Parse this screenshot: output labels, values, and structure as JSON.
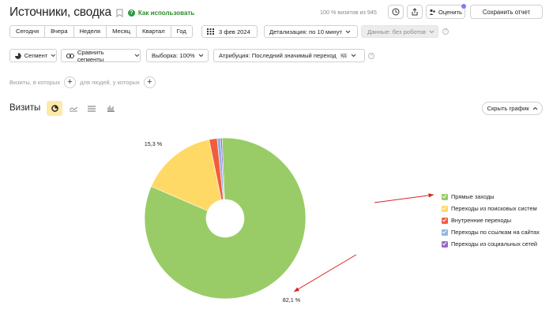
{
  "header": {
    "title": "Источники, сводка",
    "howto_label": "Как использовать",
    "visits_info": "100 % визитов из 945",
    "rate_label": "Оценить",
    "save_label": "Сохранить отчет"
  },
  "periods": [
    "Сегодня",
    "Вчера",
    "Неделя",
    "Месяц",
    "Квартал",
    "Год"
  ],
  "date_label": "3 фев 2024",
  "detail_label": "Детализация: по 10 минут",
  "robots_label": "Данные: без роботов",
  "segments": {
    "segment_label": "Сегмент",
    "compare_label": "Сравнить сегменты",
    "sample_label": "Выборка: 100%",
    "attribution_label": "Атрибуция: Последний значимый переход",
    "attribution_badge": "кд"
  },
  "filters": {
    "visits_where": "Визиты, в которых",
    "people_where": "для людей, у которых"
  },
  "section": {
    "title": "Визиты",
    "hide_graph_label": "Скрыть график"
  },
  "icons": {
    "bookmark": "bookmark-icon",
    "clock": "clock-icon",
    "share": "share-icon",
    "calendar": "calendar-icon",
    "pie": "pie-chart-icon",
    "line": "line-chart-icon",
    "area": "area-chart-icon",
    "bar": "bar-chart-icon"
  },
  "chart_data": {
    "type": "pie",
    "donut": true,
    "categories": [
      "Прямые заходы",
      "Переходы из поисковых систем",
      "Внутренние переходы",
      "Переходы по ссылкам на сайтах",
      "Переходы из социальных сетей"
    ],
    "values": [
      82.1,
      15.3,
      1.6,
      0.7,
      0.3
    ],
    "colors": [
      "#99cc66",
      "#ffd966",
      "#f25c3d",
      "#8fb5e0",
      "#9966cc"
    ],
    "data_labels": [
      "82,1 %",
      "15,3 %"
    ],
    "legend_position": "right"
  }
}
